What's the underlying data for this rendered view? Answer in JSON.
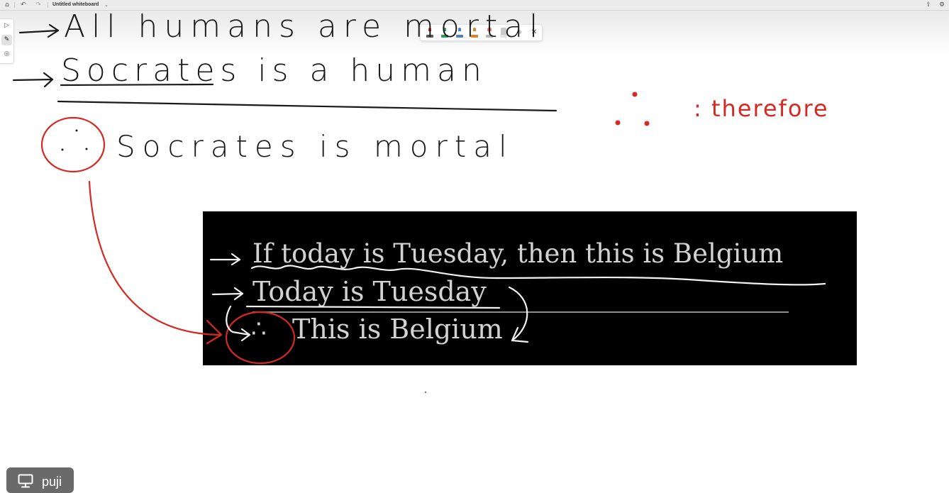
{
  "app": {
    "document_title": "Untitled whiteboard",
    "toolbar_icons": [
      "home-icon",
      "undo-icon",
      "redo-icon",
      "chevron-down-icon",
      "share-out-icon",
      "settings-icon"
    ],
    "side_tools": [
      "select-icon",
      "pen-icon",
      "lasso-icon"
    ]
  },
  "pen_tray": {
    "pens": [
      {
        "name": "red-pen",
        "color": "#d43a2f"
      },
      {
        "name": "green-pen",
        "color": "#2f9a53"
      },
      {
        "name": "blue-pen",
        "color": "#4d7fc4"
      },
      {
        "name": "orange-pen",
        "color": "#e2812d"
      },
      {
        "name": "pink-highlighter",
        "color": "#e7837d"
      },
      {
        "name": "gray-highlighter",
        "color": "#9a9a9a"
      },
      {
        "name": "eraser",
        "color": "#d9d9d9"
      }
    ],
    "ruler_icon": "ruler-icon",
    "close_icon": "close-icon",
    "close_glyph": "✕"
  },
  "slide": {
    "premise_1": "If today is Tuesday, then this is Belgium",
    "premise_2": "Today is Tuesday",
    "conclusion_symbol": "∴",
    "conclusion": "This is Belgium"
  },
  "handwriting": {
    "premise_1": "All humans are mortal",
    "premise_2": "Socrates is a human",
    "conclusion": "Socrates is mortal",
    "note_symbol": "∴",
    "note_label": ": therefore",
    "ink_black": "#1a1a1a",
    "ink_red": "#d52a24",
    "ink_white": "#f2f2f2"
  },
  "presenter": {
    "icon": "monitor-icon",
    "name": "puji"
  }
}
